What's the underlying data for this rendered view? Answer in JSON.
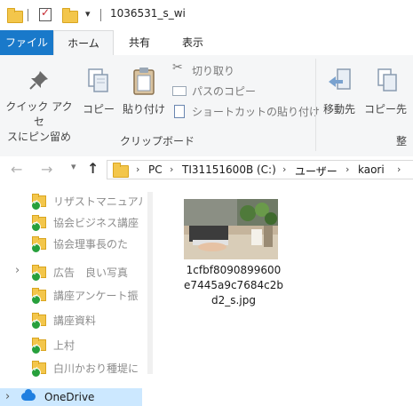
{
  "titlebar": {
    "title": "1036531_s_wi",
    "qa_dropdown_glyph": "▾"
  },
  "ribbon_tabs": [
    {
      "label": "ファイル"
    },
    {
      "label": "ホーム"
    },
    {
      "label": "共有"
    },
    {
      "label": "表示"
    }
  ],
  "ribbon": {
    "pin_quick_access": "クイック アクセ\nスにピン留め",
    "copy": "コピー",
    "paste": "貼り付け",
    "cut": "切り取り",
    "copy_path": "パスのコピー",
    "paste_shortcut": "ショートカットの貼り付け",
    "group_clipboard": "クリップボード",
    "move_to": "移動先",
    "copy_to": "コピー先",
    "group_organize_partial": "整"
  },
  "address": {
    "crumbs": [
      "PC",
      "TI31151600B (C:)",
      "ユーザー",
      "kaori"
    ],
    "back_glyph": "←",
    "forward_glyph": "→",
    "up_glyph": "↑",
    "sep_glyph": "›"
  },
  "nav_pane": {
    "items": [
      {
        "label": "リザストマニュアル"
      },
      {
        "label": "協会ビジネス講座"
      },
      {
        "label": "協会理事長のた"
      },
      {
        "label": "広告　良い写真",
        "expandable": true
      },
      {
        "label": "講座アンケート振"
      },
      {
        "label": "講座資料"
      },
      {
        "label": "上村"
      },
      {
        "label": "白川かおり種堤に"
      }
    ],
    "onedrive": {
      "label": "OneDrive"
    }
  },
  "content": {
    "file_name": "1cfbf8090899600e7445a9c7684c2bd2_s.jpg",
    "file_name_lines": [
      "1cfbf8090899600",
      "e7445a9c7684c2b",
      "d2_s.jpg"
    ]
  },
  "icons": [
    "folder-icon",
    "checkbox-icon",
    "pin-icon",
    "copy-icon",
    "paste-icon",
    "cut-icon",
    "copy-path-icon",
    "paste-shortcut-icon",
    "move-to-icon",
    "copy-to-icon",
    "onedrive-icon",
    "sync-check-icon",
    "thumbnail-image"
  ],
  "colors": {
    "file_tab": "#1979ca",
    "ribbon_bg": "#f5f6f7",
    "onedrive_selected": "#cce8ff",
    "folder": "#f3c64b",
    "sync_ok": "#27a03c"
  }
}
